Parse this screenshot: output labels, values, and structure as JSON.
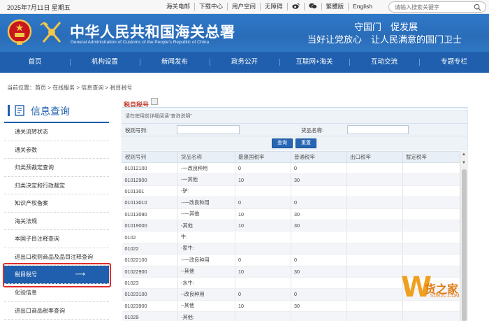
{
  "topbar": {
    "date": "2025年7月11日 星期五",
    "links": [
      "海关电邮",
      "下载中心",
      "用户空间",
      "无障碍",
      "",
      "",
      "繁體版",
      "English"
    ],
    "search_placeholder": "请输入搜索关键字"
  },
  "banner": {
    "title_cn": "中华人民共和国海关总署",
    "title_en": "General Administration of Customs of the People's Republic of China",
    "slogan_line1": "守国门　促发展",
    "slogan_line2": "当好让党放心　让人民满意的国门卫士"
  },
  "nav": [
    "首页",
    "机构设置",
    "新闻发布",
    "政务公开",
    "互联网+海关",
    "互动交流",
    "专题专栏"
  ],
  "breadcrumb": "当前位置：首页 > 在线服务 > 信息查询 > 税目税号",
  "sidebar": {
    "title": "信息查询",
    "items": [
      {
        "label": "通关流转状态"
      },
      {
        "label": "通关参数"
      },
      {
        "label": "归类预裁定查询"
      },
      {
        "label": "归类决定和行政裁定"
      },
      {
        "label": "知识产权备案"
      },
      {
        "label": "海关法规"
      },
      {
        "label": "本国子目注释查询"
      },
      {
        "label": "进出口税则商品及品目注释查询"
      },
      {
        "label": "税目税号",
        "active": true
      },
      {
        "label": "化验信息"
      },
      {
        "label": "进出口商品税率查询"
      }
    ],
    "active_arrow": "⟶"
  },
  "main": {
    "title": "税目税号",
    "note": "请在使用前详细阅读“查询说明”",
    "tax_no_label": "税则号列:",
    "goods_name_label": "货品名称:",
    "query_button": "查询",
    "reset_button": "重置",
    "columns": [
      "税则号列",
      "货品名称",
      "最惠国税率",
      "普通税率",
      "出口税率",
      "暂定税率"
    ],
    "rows": [
      [
        "01012100",
        "-一改良种用",
        "0",
        "0",
        "",
        ""
      ],
      [
        "01012900",
        "-一其他",
        "10",
        "30",
        "",
        ""
      ],
      [
        "0101301",
        "-驴:",
        "",
        "",
        "",
        ""
      ],
      [
        "01013010",
        "--一改良种用",
        "0",
        "0",
        "",
        ""
      ],
      [
        "01013090",
        "--一其他",
        "10",
        "30",
        "",
        ""
      ],
      [
        "01019000",
        "-其他",
        "10",
        "30",
        "",
        ""
      ],
      [
        "0102",
        "牛:",
        "",
        "",
        "",
        ""
      ],
      [
        "01022",
        "-家牛:",
        "",
        "",
        "",
        ""
      ],
      [
        "01022100",
        "--一改良种用",
        "0",
        "0",
        "",
        ""
      ],
      [
        "01022900",
        "--其他",
        "10",
        "30",
        "",
        ""
      ],
      [
        "01023",
        "-水牛:",
        "",
        "",
        "",
        ""
      ],
      [
        "01023100",
        "--改良种用",
        "0",
        "0",
        "",
        ""
      ],
      [
        "01023900",
        "--其他",
        "10",
        "30",
        "",
        ""
      ],
      [
        "01029",
        "-其他:",
        "",
        "",
        "",
        ""
      ]
    ]
  },
  "watermark": {
    "letter": "W",
    "text": "货之家",
    "url": "51W2C.COM"
  },
  "colors": {
    "nav": "#1f5fad",
    "banner": "#2a6cb8",
    "highlight": "#e02b2b"
  }
}
